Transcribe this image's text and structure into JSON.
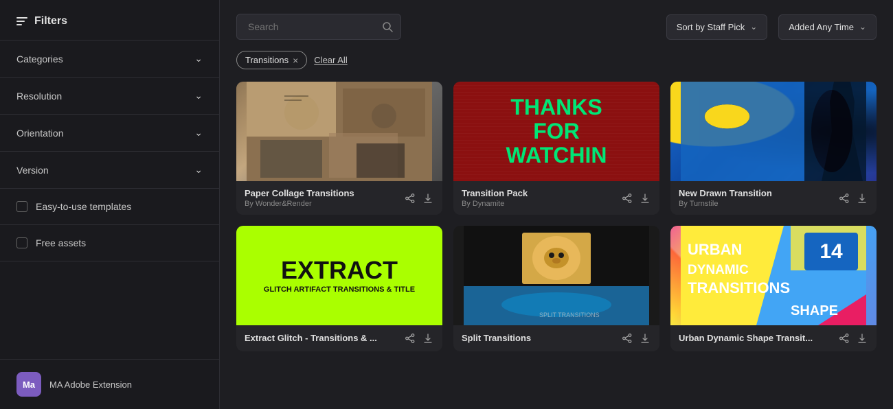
{
  "sidebar": {
    "title": "Filters",
    "sections": [
      {
        "label": "Categories",
        "id": "categories"
      },
      {
        "label": "Resolution",
        "id": "resolution"
      },
      {
        "label": "Orientation",
        "id": "orientation"
      },
      {
        "label": "Version",
        "id": "version"
      }
    ],
    "checkboxes": [
      {
        "label": "Easy-to-use templates",
        "id": "easy-templates",
        "checked": false
      },
      {
        "label": "Free assets",
        "id": "free-assets",
        "checked": false
      }
    ],
    "footer": {
      "avatar_text": "Ma",
      "label": "MA Adobe Extension"
    }
  },
  "topbar": {
    "search_placeholder": "Search",
    "sort_label": "Sort by Staff Pick",
    "time_label": "Added Any Time"
  },
  "filter_tags": [
    {
      "label": "Transitions",
      "id": "transitions"
    }
  ],
  "clear_all_label": "Clear All",
  "cards": [
    {
      "id": "card-1",
      "title": "Paper Collage Transitions",
      "author": "By Wonder&Render",
      "thumb_type": "thumb-1"
    },
    {
      "id": "card-2",
      "title": "Transition Pack",
      "author": "By Dynamite",
      "thumb_type": "thumb-2"
    },
    {
      "id": "card-3",
      "title": "New Drawn Transition",
      "author": "By Turnstile",
      "thumb_type": "thumb-3"
    },
    {
      "id": "card-4",
      "title": "Extract Glitch - Transitions & ...",
      "author": "",
      "thumb_type": "thumb-4"
    },
    {
      "id": "card-5",
      "title": "Split Transitions",
      "author": "",
      "thumb_type": "thumb-5"
    },
    {
      "id": "card-6",
      "title": "Urban Dynamic Shape Transit...",
      "author": "",
      "thumb_type": "thumb-6"
    }
  ]
}
